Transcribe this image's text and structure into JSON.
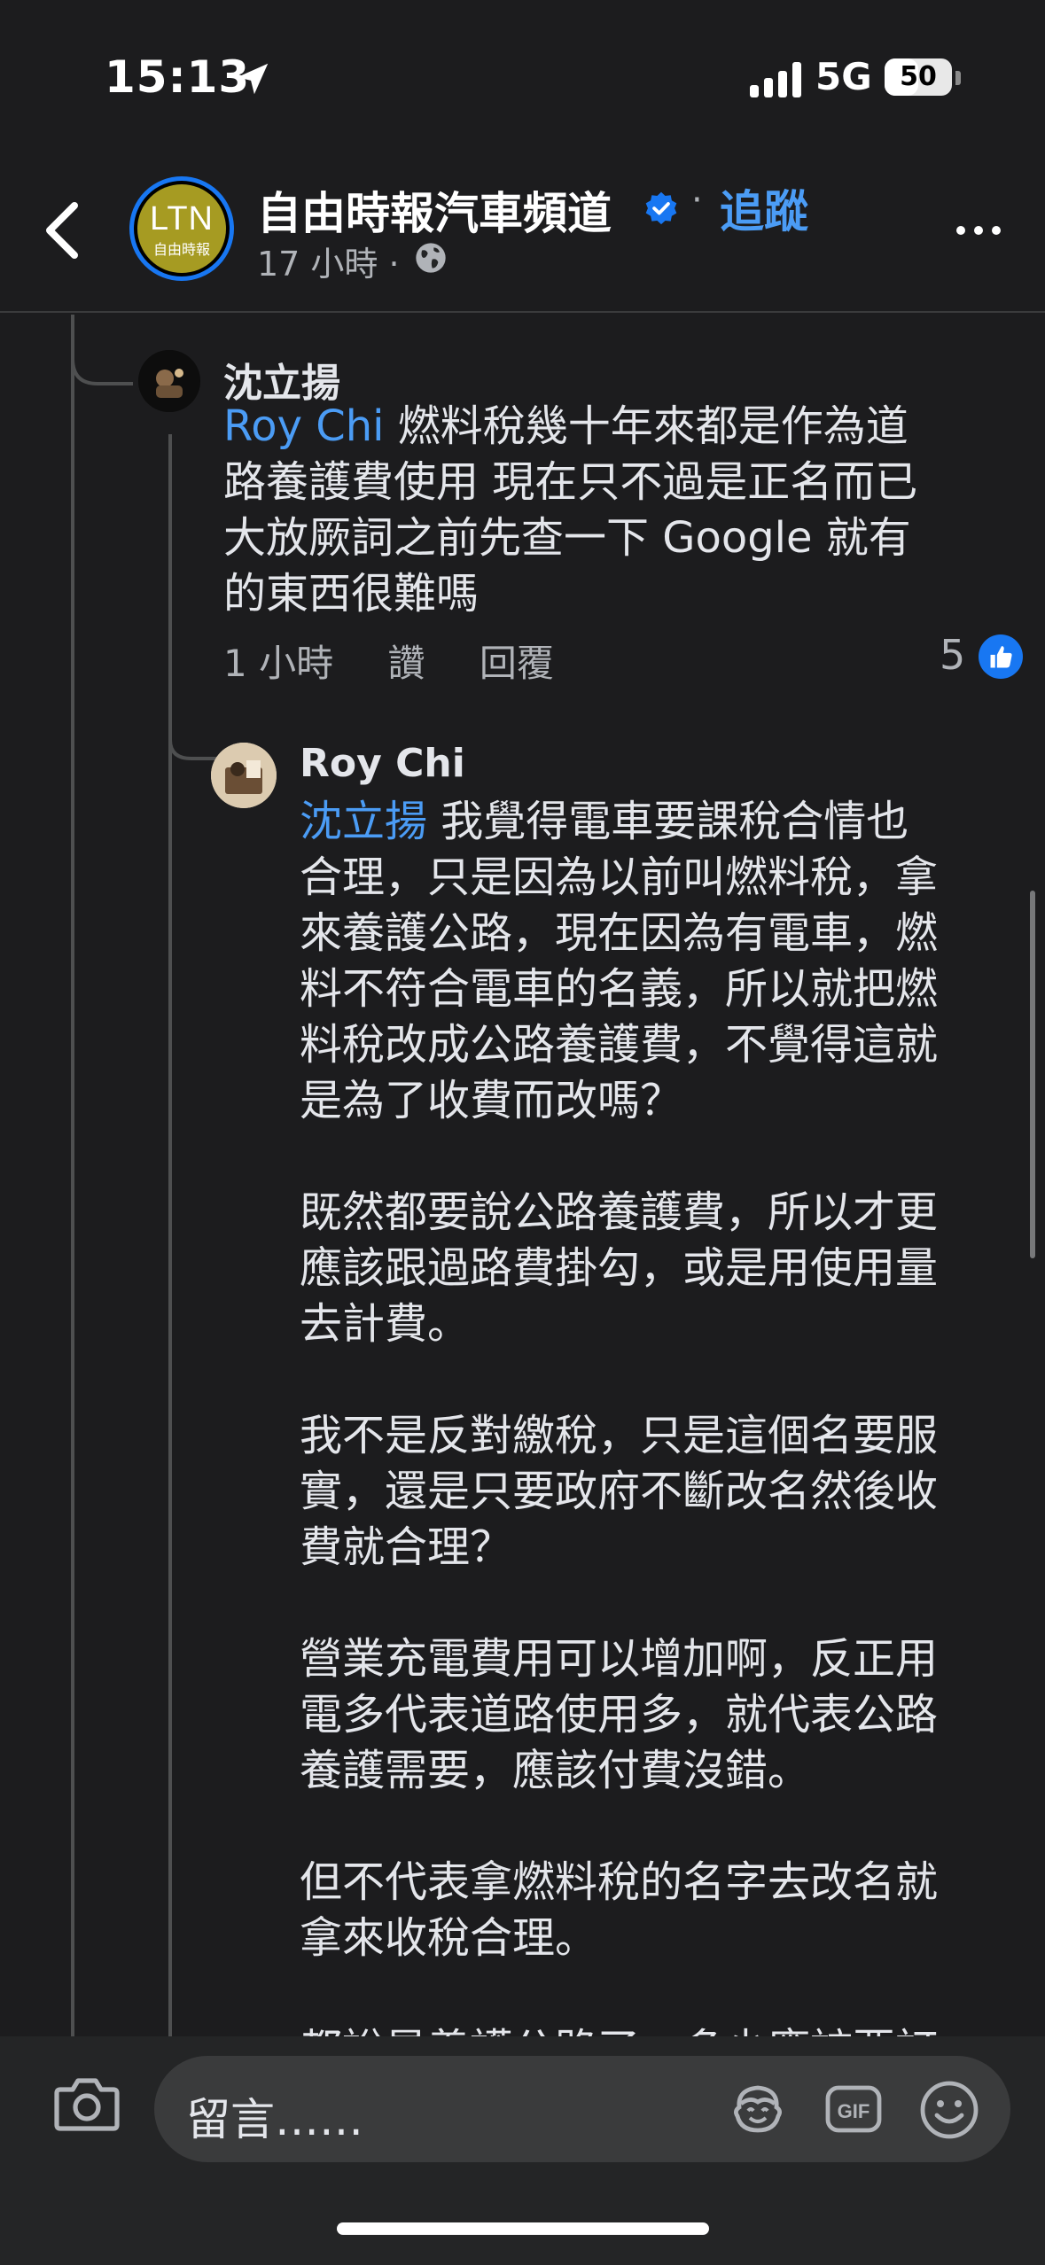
{
  "status_bar": {
    "time": "15:13",
    "network": "5G",
    "battery_percent": "50",
    "battery_level": 0.5
  },
  "header": {
    "page_name": "自由時報汽車頻道",
    "follow_label": "追蹤",
    "separator": "·",
    "post_time": "17 小時 ·",
    "avatar_logo": "LTN",
    "avatar_logo_sub": "自由時報"
  },
  "comments": [
    {
      "author": "沈立揚",
      "mention": "Roy Chi",
      "text": " 燃料稅幾十年來都是作為道\n路養護費使用 現在只不過是正名而已\n大放厥詞之前先查一下 Google 就有\n的東西很難嗎",
      "time": "1 小時",
      "like_label": "讚",
      "reply_label": "回覆",
      "likes": "5"
    },
    {
      "author": "Roy Chi",
      "mention": "沈立揚",
      "text": " 我覺得電車要課稅合情也\n合理，只是因為以前叫燃料稅，拿\n來養護公路，現在因為有電車，燃\n料不符合電車的名義，所以就把燃\n料稅改成公路養護費，不覺得這就\n是為了收費而改嗎？\n\n既然都要說公路養護費，所以才更\n應該跟過路費掛勾，或是用使用量\n去計費。\n\n我不是反對繳稅，只是這個名要服\n實，還是只要政府不斷改名然後收\n費就合理？\n\n營業充電費用可以增加啊，反正用\n電多代表道路使用多，就代表公路\n養護需要，應該付費沒錯。\n\n但不代表拿燃料稅的名字去改名就\n拿來收稅合理。\n\n都說是養護公路了，多少應該要訂"
    }
  ],
  "composer": {
    "placeholder": "留言……",
    "gif_label": "GIF"
  },
  "colors": {
    "background": "#1c1c1e",
    "accent": "#4b9cf5",
    "verified": "#1877f2"
  }
}
